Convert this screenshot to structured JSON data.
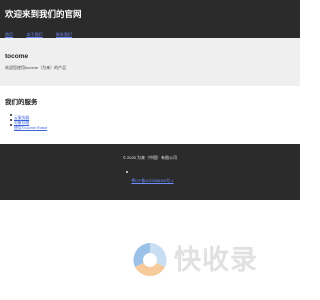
{
  "header": {
    "title": "欢迎来到我们的官网",
    "nav": [
      "首页",
      "关于我们",
      "联系我们"
    ]
  },
  "intro": {
    "company": "tocome",
    "description": "欢迎您使用tocome（为来）的产品"
  },
  "services": {
    "title": "我们的服务",
    "items": [
      "云服务器",
      "对象存储",
      "使用To.come Robot"
    ]
  },
  "footer": {
    "copyright": "© 2025 为来（中国）有限公司",
    "icp": "粤ICP备2025388396号-1"
  },
  "watermark": {
    "text": "快收录",
    "colors": {
      "blue": "#4a8fd6",
      "orange": "#f0a04b",
      "text": "#c9c9c9"
    }
  },
  "colors": {
    "header_bg": "#2b2b2b",
    "intro_bg": "#efefef",
    "link": "#3b62d9",
    "nav_link": "#6d8cff"
  }
}
